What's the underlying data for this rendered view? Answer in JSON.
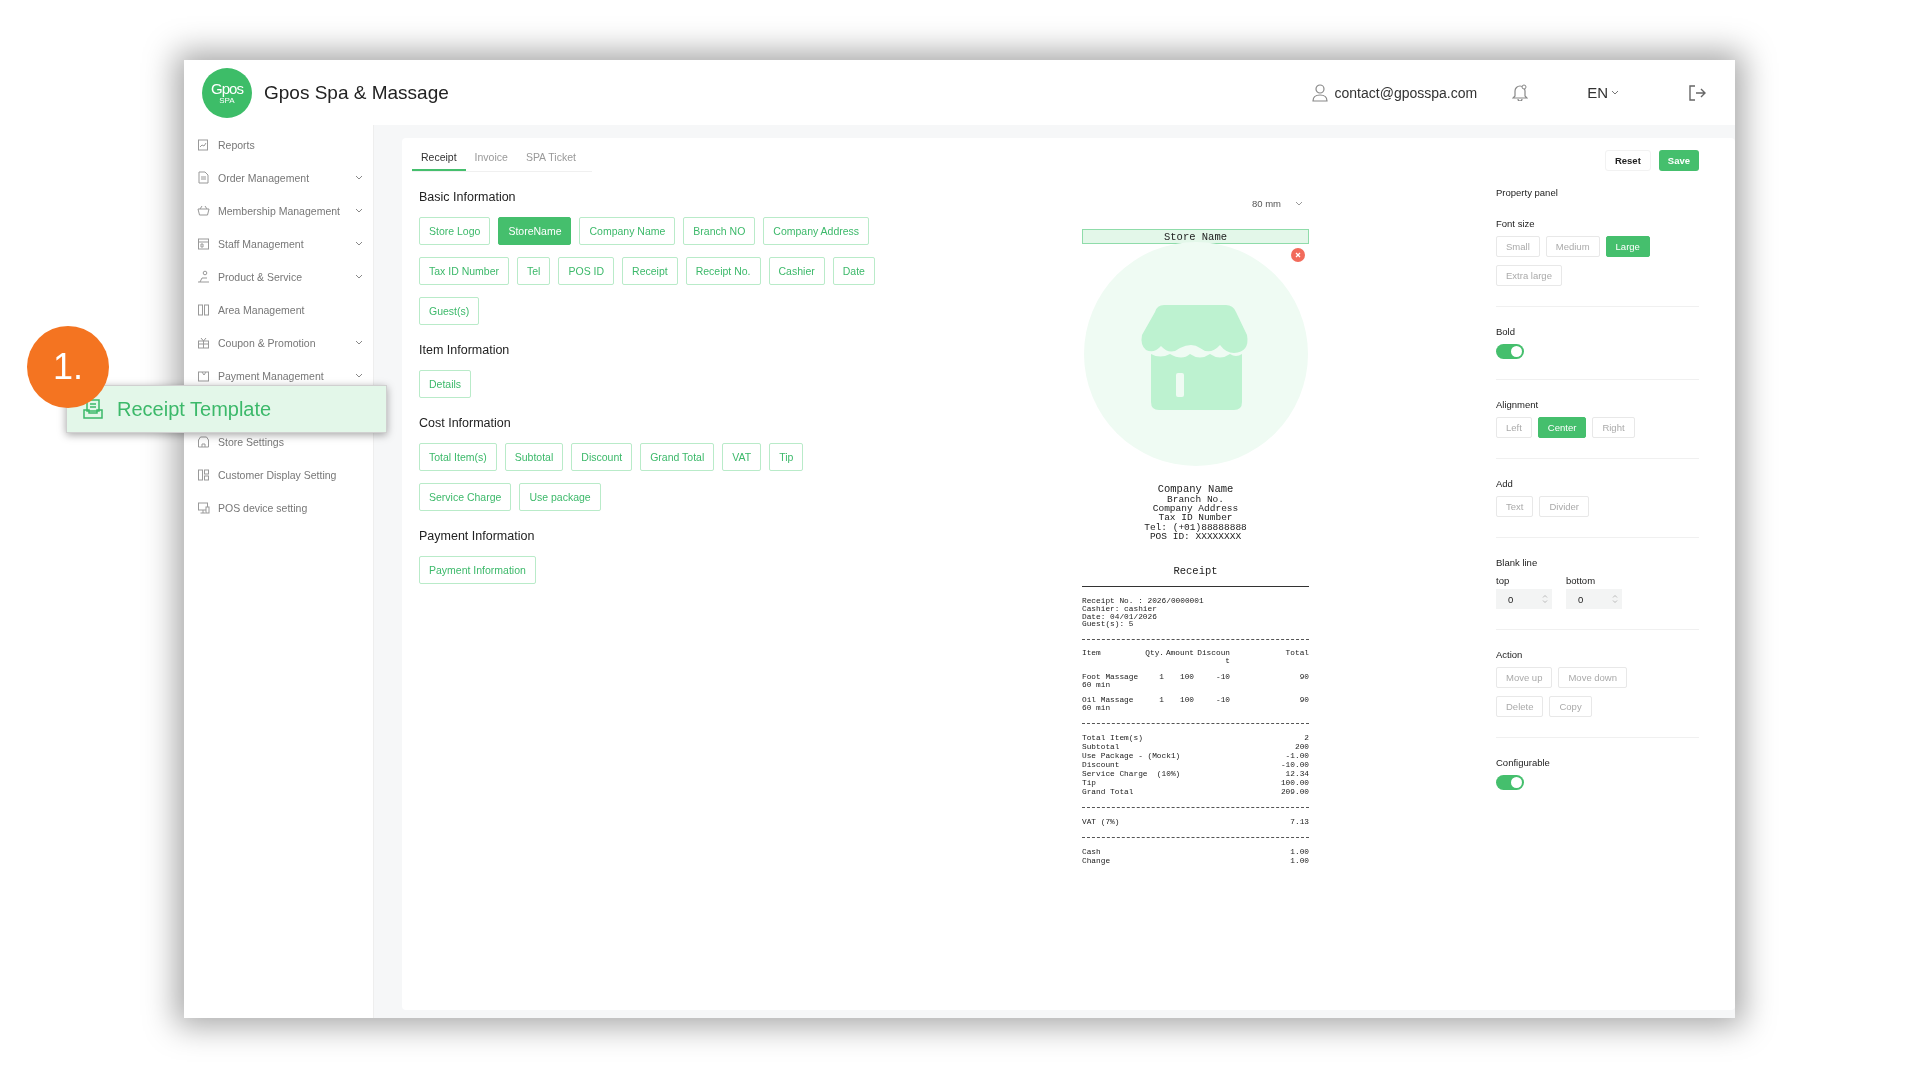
{
  "header": {
    "logo": {
      "text": "Gpos",
      "subtext": "SPA"
    },
    "title": "Gpos Spa & Massage",
    "user_email": "contact@gposspa.com",
    "language": "EN"
  },
  "callout": {
    "number": "1."
  },
  "sidebar": {
    "items": [
      {
        "label": "Reports",
        "expandable": false,
        "selected": false
      },
      {
        "label": "Order Management",
        "expandable": true,
        "selected": false
      },
      {
        "label": "Membership Management",
        "expandable": true,
        "selected": false
      },
      {
        "label": "Staff Management",
        "expandable": true,
        "selected": false
      },
      {
        "label": "Product & Service",
        "expandable": true,
        "selected": false
      },
      {
        "label": "Area Management",
        "expandable": false,
        "selected": false
      },
      {
        "label": "Coupon & Promotion",
        "expandable": true,
        "selected": false
      },
      {
        "label": "Payment Management",
        "expandable": true,
        "selected": false
      },
      {
        "label": "Receipt Template",
        "expandable": false,
        "selected": true
      },
      {
        "label": "Store Settings",
        "expandable": false,
        "selected": false
      },
      {
        "label": "Customer Display Setting",
        "expandable": false,
        "selected": false
      },
      {
        "label": "POS device setting",
        "expandable": false,
        "selected": false
      }
    ]
  },
  "tabs": [
    {
      "label": "Receipt",
      "selected": true
    },
    {
      "label": "Invoice",
      "selected": false
    },
    {
      "label": "SPA Ticket",
      "selected": false
    }
  ],
  "sections": [
    {
      "title": "Basic Information",
      "fields": [
        {
          "label": "Store Logo",
          "selected": false
        },
        {
          "label": "StoreName",
          "selected": true
        },
        {
          "label": "Company Name",
          "selected": false
        },
        {
          "label": "Branch NO",
          "selected": false
        },
        {
          "label": "Company Address",
          "selected": false
        },
        {
          "label": "Tax ID Number",
          "selected": false
        },
        {
          "label": "Tel",
          "selected": false
        },
        {
          "label": "POS ID",
          "selected": false
        },
        {
          "label": "Receipt",
          "selected": false
        },
        {
          "label": "Receipt No.",
          "selected": false
        },
        {
          "label": "Cashier",
          "selected": false
        },
        {
          "label": "Date",
          "selected": false
        },
        {
          "label": "Guest(s)",
          "selected": false
        }
      ]
    },
    {
      "title": "Item Information",
      "fields": [
        {
          "label": "Details",
          "selected": false
        }
      ]
    },
    {
      "title": "Cost Information",
      "fields": [
        {
          "label": "Total Item(s)",
          "selected": false
        },
        {
          "label": "Subtotal",
          "selected": false
        },
        {
          "label": "Discount",
          "selected": false
        },
        {
          "label": "Grand Total",
          "selected": false
        },
        {
          "label": "VAT",
          "selected": false
        },
        {
          "label": "Tip",
          "selected": false
        },
        {
          "label": "Service Charge",
          "selected": false
        },
        {
          "label": "Use package",
          "selected": false
        }
      ]
    },
    {
      "title": "Payment Information",
      "fields": [
        {
          "label": "Payment Information",
          "selected": false
        }
      ]
    }
  ],
  "preview": {
    "paper_width": "80 mm",
    "store_name": {
      "text": "Store Name",
      "selected": true
    },
    "company_lines": [
      "Company Name",
      "Branch No.",
      "Company Address",
      "Tax ID Number",
      "Tel: (+01)88888888",
      "POS ID: XXXXXXXX"
    ],
    "title": "Receipt",
    "info_lines": [
      "Receipt No. : 2026/0000001",
      "Cashier: cashier",
      "Date: 04/01/2026",
      "Guest(s): 5"
    ],
    "item_columns": [
      "Item",
      "Qty.",
      "Amount",
      "Discount",
      "Total"
    ],
    "items": [
      [
        "Foot Massage 60 min",
        "1",
        "100",
        "-10",
        "90"
      ],
      [
        "Oil Massage 60 min",
        "1",
        "100",
        "-10",
        "90"
      ]
    ],
    "totals": [
      {
        "label": "Total Item(s)",
        "value": "2"
      },
      {
        "label": "Subtotal",
        "value": "200"
      },
      {
        "label": "Use Package - (Mock1)",
        "value": "-1.00"
      },
      {
        "label": "Discount",
        "value": "-10.00"
      },
      {
        "label": "Service Charge  (10%)",
        "value": "12.34"
      },
      {
        "label": "Tip",
        "value": "100.00"
      },
      {
        "label": "Grand Total",
        "value": "209.00"
      }
    ],
    "vat": {
      "label": "VAT (7%)",
      "value": "7.13"
    },
    "payments": [
      {
        "label": "Cash",
        "value": "1.00"
      },
      {
        "label": "Change",
        "value": "1.00"
      }
    ]
  },
  "actions": {
    "reset": "Reset",
    "save": "Save"
  },
  "property_panel": {
    "title": "Property panel",
    "groups": [
      {
        "kind": "options",
        "label": "Font size",
        "options": [
          {
            "label": "Small",
            "selected": false
          },
          {
            "label": "Medium",
            "selected": false
          },
          {
            "label": "Large",
            "selected": true
          },
          {
            "label": "Extra large",
            "selected": false
          }
        ]
      },
      {
        "kind": "toggle",
        "label": "Bold",
        "on": true
      },
      {
        "kind": "options",
        "label": "Alignment",
        "options": [
          {
            "label": "Left",
            "selected": false
          },
          {
            "label": "Center",
            "selected": true
          },
          {
            "label": "Right",
            "selected": false
          }
        ]
      },
      {
        "kind": "buttons",
        "label": "Add",
        "buttons": [
          "Text",
          "Divider"
        ]
      },
      {
        "kind": "numbers",
        "label": "Blank line",
        "fields": [
          {
            "label": "top",
            "value": "0"
          },
          {
            "label": "bottom",
            "value": "0"
          }
        ]
      },
      {
        "kind": "buttons",
        "label": "Action",
        "buttons": [
          "Move up",
          "Move down",
          "Delete",
          "Copy"
        ]
      },
      {
        "kind": "toggle",
        "label": "Configurable",
        "on": true
      }
    ]
  }
}
